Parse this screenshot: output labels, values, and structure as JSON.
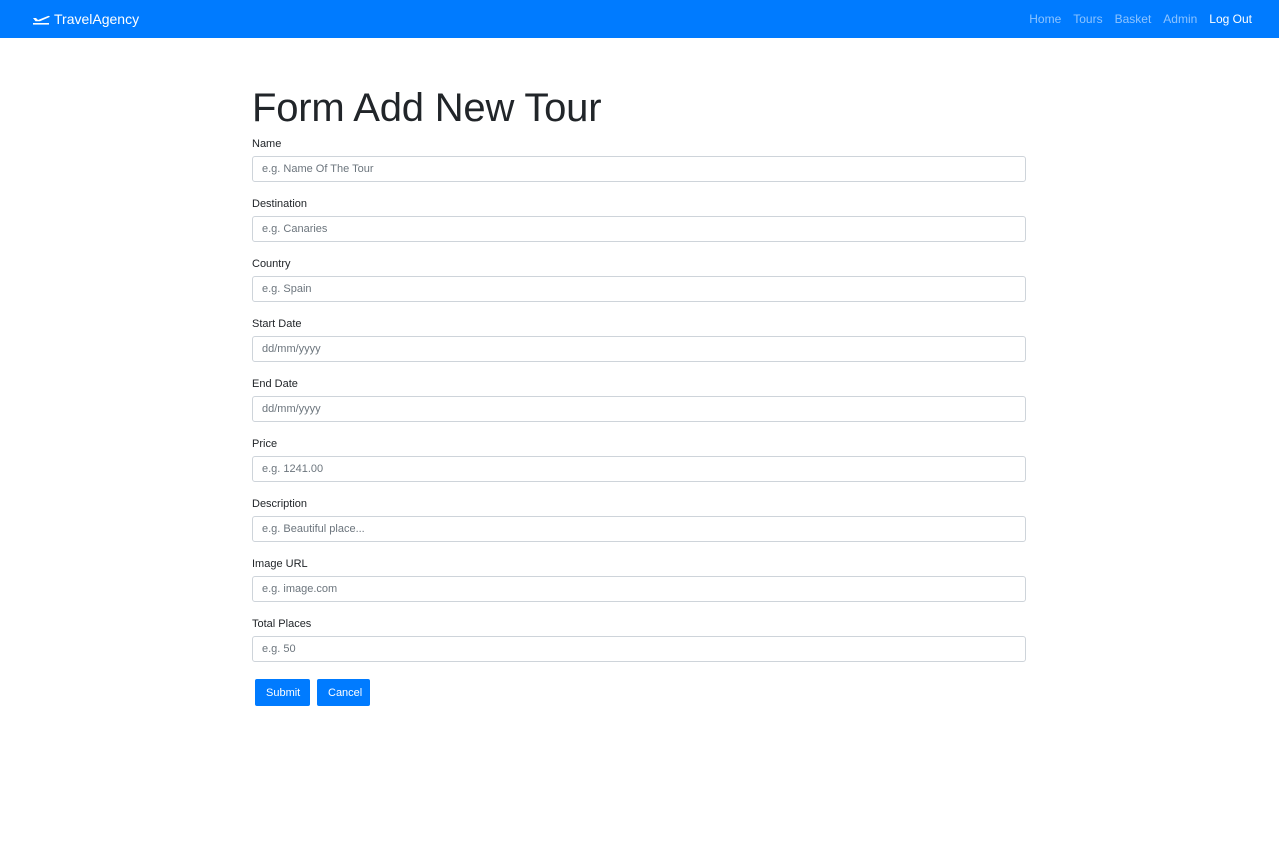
{
  "navbar": {
    "brand": "TravelAgency",
    "brand_icon": "plane-departure-icon",
    "links": [
      {
        "label": "Home",
        "active": false
      },
      {
        "label": "Tours",
        "active": false
      },
      {
        "label": "Basket",
        "active": false
      },
      {
        "label": "Admin",
        "active": false
      },
      {
        "label": "Log Out",
        "active": true
      }
    ],
    "color": "#007bff"
  },
  "form": {
    "title": "Form Add New Tour",
    "fields": [
      {
        "label": "Name",
        "placeholder": "e.g. Name Of The Tour",
        "value": ""
      },
      {
        "label": "Destination",
        "placeholder": "e.g. Canaries",
        "value": ""
      },
      {
        "label": "Country",
        "placeholder": "e.g. Spain",
        "value": ""
      },
      {
        "label": "Start Date",
        "placeholder": "dd/mm/yyyy",
        "value": ""
      },
      {
        "label": "End Date",
        "placeholder": "dd/mm/yyyy",
        "value": ""
      },
      {
        "label": "Price",
        "placeholder": "e.g. 1241.00",
        "value": ""
      },
      {
        "label": "Description",
        "placeholder": "e.g. Beautiful place...",
        "value": ""
      },
      {
        "label": "Image URL",
        "placeholder": "e.g. image.com",
        "value": ""
      },
      {
        "label": "Total Places",
        "placeholder": "e.g. 50",
        "value": ""
      }
    ],
    "submit_label": "Submit",
    "cancel_label": "Cancel",
    "button_color": "#007bff"
  }
}
